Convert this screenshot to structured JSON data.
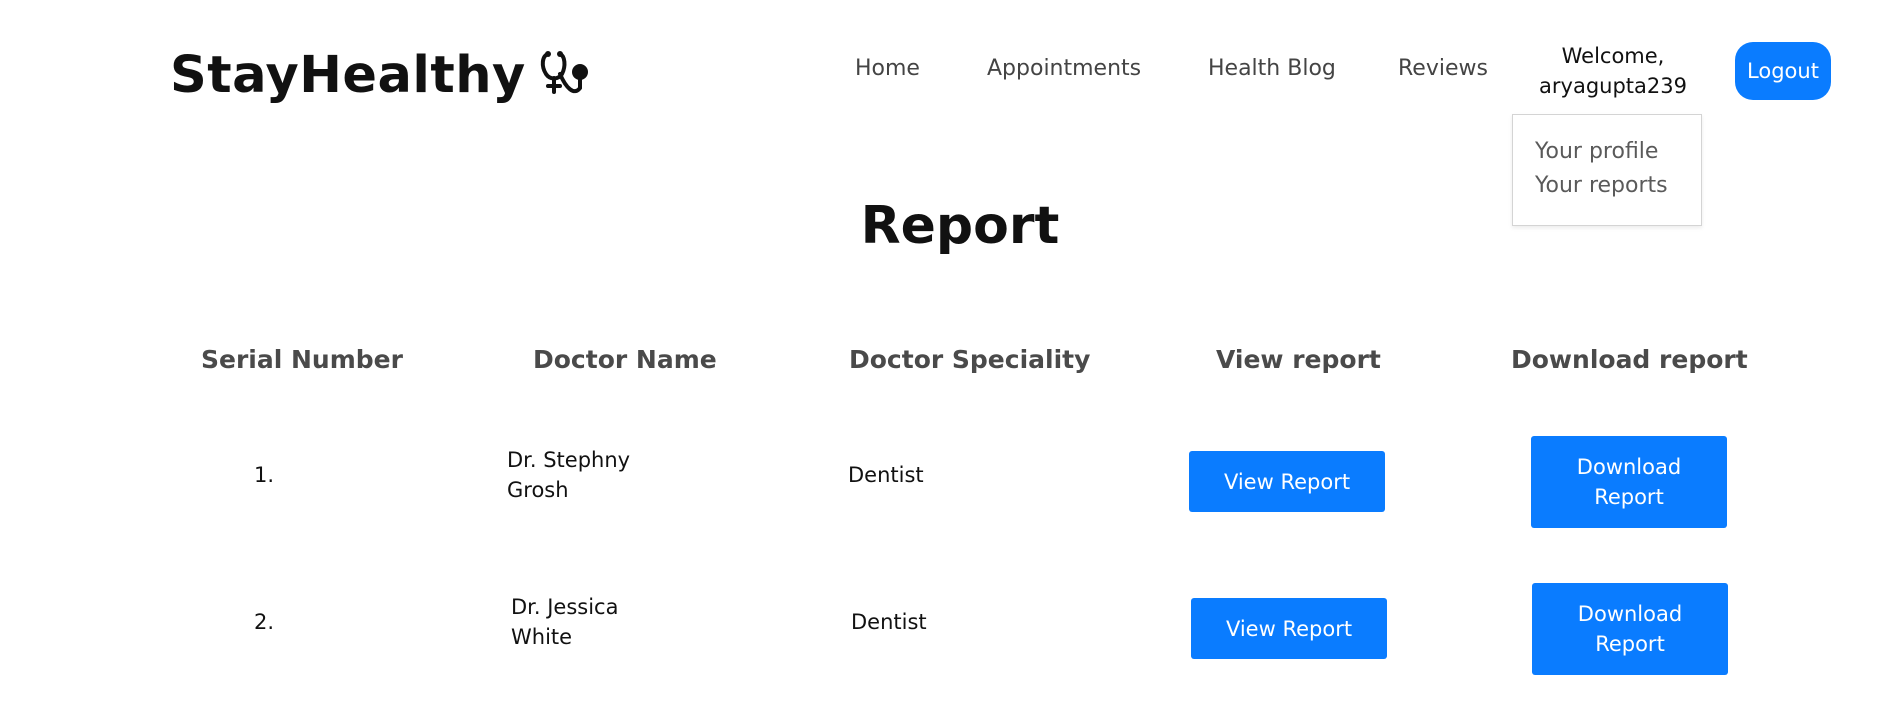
{
  "brand": {
    "name": "StayHealthy",
    "icon": "stethoscope-icon"
  },
  "nav": {
    "items": [
      "Home",
      "Appointments",
      "Health Blog",
      "Reviews"
    ],
    "welcome_line1": "Welcome,",
    "welcome_line2": "aryagupta239",
    "logout_label": "Logout"
  },
  "user_menu": {
    "items": [
      "Your profile",
      "Your reports"
    ]
  },
  "page": {
    "title": "Report"
  },
  "table": {
    "headers": [
      "Serial Number",
      "Doctor Name",
      "Doctor Speciality",
      "View report",
      "Download report"
    ],
    "rows": [
      {
        "serial": "1.",
        "doctor_first": "Dr. Stephny",
        "doctor_last": "Grosh",
        "speciality": "Dentist",
        "view_label": "View Report",
        "download_line1": "Download",
        "download_line2": "Report"
      },
      {
        "serial": "2.",
        "doctor_first": "Dr. Jessica",
        "doctor_last": "White",
        "speciality": "Dentist",
        "view_label": "View Report",
        "download_line1": "Download",
        "download_line2": "Report"
      }
    ]
  },
  "colors": {
    "accent": "#0a7cff",
    "text": "#111111",
    "header_text": "#4a4a4a"
  }
}
